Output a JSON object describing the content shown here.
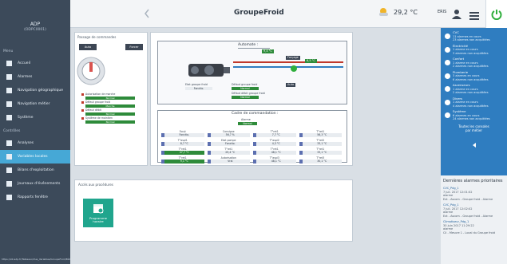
{
  "sidebar": {
    "brand_title": "ADP",
    "brand_sub": "(ODPC0001)",
    "section1": "Menu",
    "section2": "Contrôles",
    "items": [
      {
        "label": "Accueil",
        "icon": "home-icon"
      },
      {
        "label": "Alarmes",
        "icon": "bell-icon"
      },
      {
        "label": "Navigation géographique",
        "icon": "map-pin-icon"
      },
      {
        "label": "Navigation métier",
        "icon": "tools-icon"
      },
      {
        "label": "Système",
        "icon": "gear-icon"
      }
    ],
    "items2": [
      {
        "label": "Analyses",
        "icon": "chart-icon"
      },
      {
        "label": "Variables locales",
        "icon": "list-icon",
        "active": true
      },
      {
        "label": "Bilans d'exploitation",
        "icon": "sigma-icon"
      },
      {
        "label": "Journaux d'événements",
        "icon": "calendar-icon"
      },
      {
        "label": "Rapports fenêtre",
        "icon": "report-icon"
      }
    ],
    "footer_text": "https://iot.adp.fr/Tableaux/Vue_Variables/GroupeFroid/Bâtiment-E/Chaufferie-Clim/GroupeFroid"
  },
  "topbar": {
    "title": "GroupeFroid",
    "temperature": "29,2 °C",
    "user": "ERIS"
  },
  "alarms": {
    "groups": [
      {
        "name": "CVC",
        "line1": "11 alarmes en cours",
        "line2": "23 alarmes non acquittées",
        "icon": "hvac-icon"
      },
      {
        "name": "Électricité",
        "line1": "1 alarme en cours",
        "line2": "3 alarmes non acquittées",
        "icon": "lightning-icon"
      },
      {
        "name": "Confort",
        "line1": "1 alarme en cours",
        "line2": "2 alarmes non acquittées",
        "icon": "bulb-icon"
      },
      {
        "name": "Plomberie",
        "line1": "3 alarmes en cours",
        "line2": "6 alarmes non acquittées",
        "icon": "pipe-icon"
      },
      {
        "name": "Ascenseurs",
        "line1": "1 alarme en cours",
        "line2": "2 alarmes non acquittées",
        "icon": "elevator-icon"
      },
      {
        "name": "Divers",
        "line1": "1 alarme en cours",
        "line2": "4 alarmes non acquittées",
        "icon": "cube-icon"
      },
      {
        "name": "Système",
        "line1": "6 alarmes en cours",
        "line2": "24 alarmes non acquittées",
        "icon": "gear-icon"
      }
    ],
    "toutes_line1": "Toutes les consoles",
    "toutes_line2": "par métier",
    "recent_title": "Dernières alarmes prioritaires",
    "recent": [
      {
        "name": "CVC_Pdg_1",
        "date": "7 juil. 2017 12:01:02",
        "state": "alarme",
        "detail": "Ext - Ascom - Groupe froid - Alarme"
      },
      {
        "name": "CVC_Pdg_1",
        "date": "7 juil. 2017 12:02:02",
        "state": "alarme",
        "detail": "Ext - Ascom - Groupe froid - Alarme"
      },
      {
        "name": "Climatiseur_Pdg_1",
        "date": "30 juin 2017 11:29:22",
        "state": "alarme",
        "detail": "Cli - Mesure 1 - Local du Groupe froid"
      }
    ]
  },
  "left_card": {
    "title": "Passage de commandes",
    "btn_auto": "Auto",
    "btn_forcer": "Forcer",
    "status": [
      {
        "label": "Autorisation de marche",
        "value": "Normal"
      },
      {
        "label": "Défaut groupe froid",
        "value": "Marche"
      },
      {
        "label": "Défaut débit",
        "value": "Normal"
      },
      {
        "label": "Système de maintien",
        "value": "Normal"
      }
    ]
  },
  "main_card": {
    "auto_title": "Automate :",
    "temp1": "9,4 °C",
    "temp2": "6,5 °C",
    "forcage": "Forçage",
    "auto": "Auto",
    "etat_groupe": "Etat groupe froid",
    "etat_value": "Fonctio.",
    "defaut_groupe": "Défaut groupe froid",
    "defaut_value": "Normal",
    "defaut_debit": "Défaut débit groupe froid",
    "defaut_debit_value": "Normal",
    "cmd_title": "Cadre de commandation :",
    "alarme_label": "Alarme",
    "alarme_value": "Normal",
    "rows": [
      [
        {
          "name": "Forçt",
          "value": "Fonctio."
        },
        {
          "name": "Consigne",
          "value": "56,7 %"
        },
        {
          "name": "T°ret1",
          "value": "7,7 °C"
        },
        {
          "name": "T°ret1",
          "value": "56,3 °C"
        }
      ],
      [
        {
          "name": "T°aspi1",
          "value": "8,7 °C"
        },
        {
          "name": "Etat pompe",
          "value": "Fonctio."
        },
        {
          "name": "T°aspi2",
          "value": "4,3 °C"
        },
        {
          "name": "T°ret2",
          "value": "33,1 °C"
        }
      ],
      [
        {
          "name": "T°ret1",
          "value": "47,7 °C",
          "green": true
        },
        {
          "name": "T°ret1",
          "value": "29,4 °C"
        },
        {
          "name": "T°ret1",
          "value": "48,1 °C"
        },
        {
          "name": "T°ret1",
          "value": "33,1 °C"
        }
      ],
      [
        {
          "name": "T°ret1",
          "value": "9,1 °C",
          "green": true
        },
        {
          "name": "Autorisation",
          "value": "Vrai"
        },
        {
          "name": "T°aspi3",
          "value": "48,1 °C"
        },
        {
          "name": "T°ret3",
          "value": "30,1 °C"
        }
      ]
    ]
  },
  "access_card": {
    "title": "Accès aux procédures",
    "tile_line1": "Programme",
    "tile_line2": "horaire"
  },
  "colors": {
    "sidebar_bg": "#3c4a5a",
    "accent": "#46a8d6",
    "alarm_panel": "#2f7dc0",
    "tile": "#20a58d",
    "ok": "#2e8b3a"
  }
}
